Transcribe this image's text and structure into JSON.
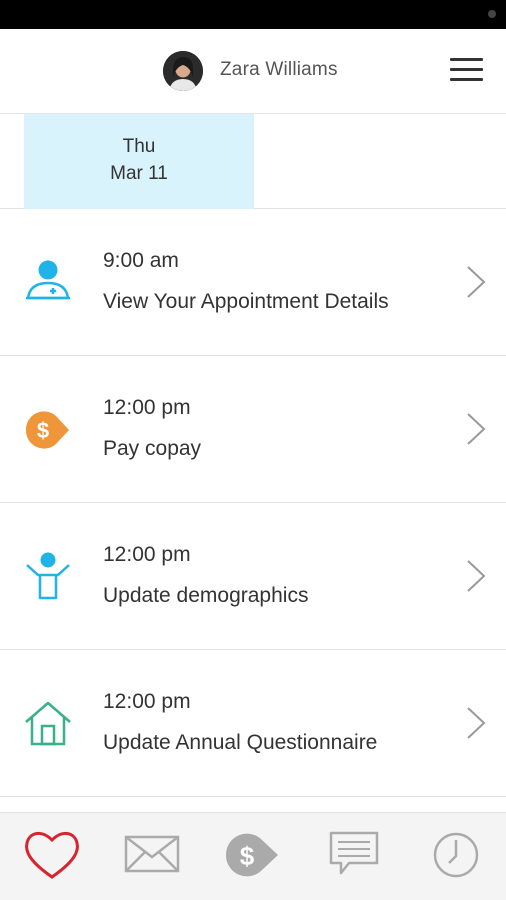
{
  "header": {
    "user_name": "Zara Williams"
  },
  "date": {
    "day": "Thu",
    "month_day": "Mar 11"
  },
  "tasks": [
    {
      "time": "9:00 am",
      "title": "View Your Appointment Details",
      "icon": "appointment-person-icon"
    },
    {
      "time": "12:00 pm",
      "title": "Pay copay",
      "icon": "dollar-tag-icon"
    },
    {
      "time": "12:00 pm",
      "title": "Update demographics",
      "icon": "person-arms-up-icon"
    },
    {
      "time": "12:00 pm",
      "title": "Update Annual Questionnaire",
      "icon": "house-icon"
    }
  ],
  "tabbar": [
    "heart-icon",
    "mail-icon",
    "dollar-tag-icon",
    "chat-icon",
    "clock-icon"
  ],
  "colors": {
    "accent_blue": "#1fb3e8",
    "accent_orange": "#f0963a",
    "accent_green": "#3ab08a",
    "heart_red": "#d9232e",
    "date_highlight": "#d9f3fd"
  }
}
